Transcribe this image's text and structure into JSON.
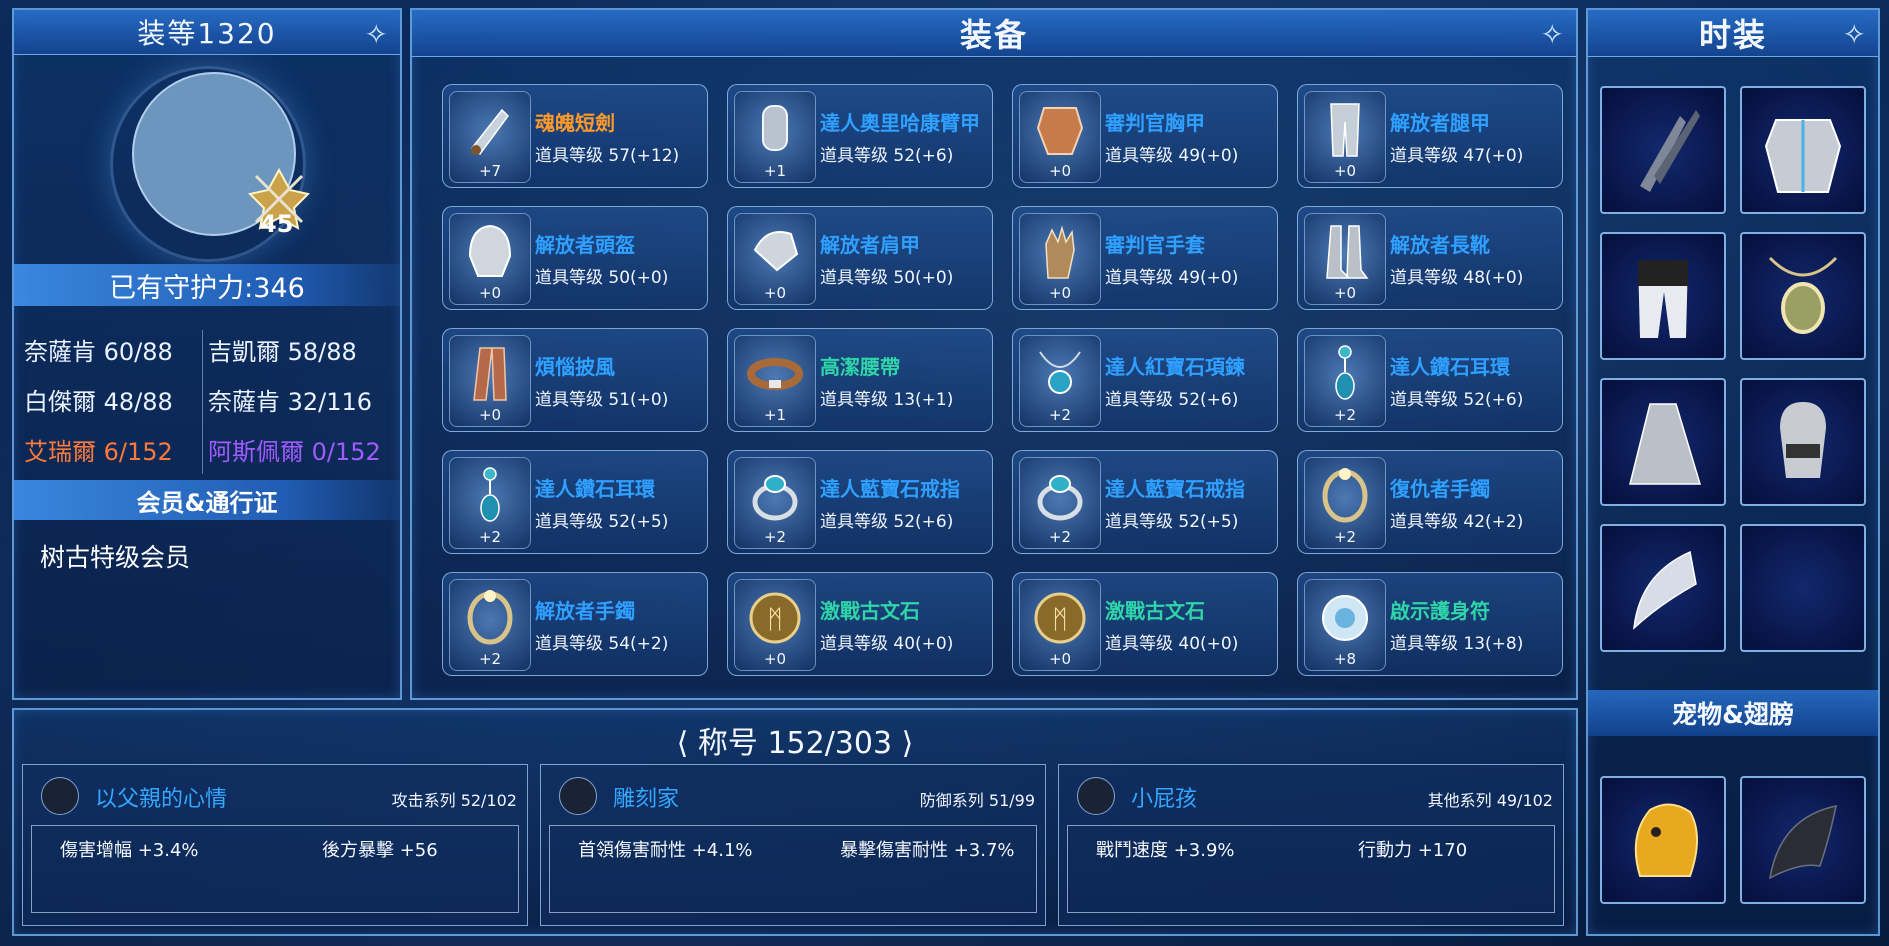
{
  "left_panel": {
    "gear_score": "装等1320",
    "level": "45",
    "guard_power": "已有守护力:346",
    "stats": [
      {
        "label": "奈薩肯 60/88",
        "color": "#eaf2ff"
      },
      {
        "label": "吉凱爾 58/88",
        "color": "#eaf2ff"
      },
      {
        "label": "白傑爾 48/88",
        "color": "#eaf2ff"
      },
      {
        "label": "奈薩肯 32/116",
        "color": "#eaf2ff"
      },
      {
        "label": "艾瑞爾 6/152",
        "color": "#ff7a3a"
      },
      {
        "label": "阿斯佩爾 0/152",
        "color": "#a05bff"
      }
    ],
    "membership_header": "会员&通行证",
    "membership": "树古特级会员"
  },
  "equipment": {
    "title": "装备",
    "items": [
      {
        "name": "魂魄短劍",
        "level": "道具等级 57(+12)",
        "plus": "+7",
        "name_color": "#ff9a2a",
        "icon": "dagger-icon"
      },
      {
        "name": "達人奧里哈康臂甲",
        "level": "道具等级 52(+6)",
        "plus": "+1",
        "name_color": "#2fa0ff",
        "icon": "bracer-icon"
      },
      {
        "name": "審判官胸甲",
        "level": "道具等级 49(+0)",
        "plus": "+0",
        "name_color": "#2fa0ff",
        "icon": "chest-armor-icon"
      },
      {
        "name": "解放者腿甲",
        "level": "道具等级 47(+0)",
        "plus": "+0",
        "name_color": "#2fa0ff",
        "icon": "leg-armor-icon"
      },
      {
        "name": "解放者頭盔",
        "level": "道具等级 50(+0)",
        "plus": "+0",
        "name_color": "#2fa0ff",
        "icon": "helmet-icon"
      },
      {
        "name": "解放者肩甲",
        "level": "道具等级 50(+0)",
        "plus": "+0",
        "name_color": "#2fa0ff",
        "icon": "shoulder-icon"
      },
      {
        "name": "審判官手套",
        "level": "道具等级 49(+0)",
        "plus": "+0",
        "name_color": "#2fa0ff",
        "icon": "glove-icon"
      },
      {
        "name": "解放者長靴",
        "level": "道具等级 48(+0)",
        "plus": "+0",
        "name_color": "#2fa0ff",
        "icon": "boots-icon"
      },
      {
        "name": "煩惱披風",
        "level": "道具等级 51(+0)",
        "plus": "+0",
        "name_color": "#2fa0ff",
        "icon": "cape-icon"
      },
      {
        "name": "高潔腰帶",
        "level": "道具等级 13(+1)",
        "plus": "+1",
        "name_color": "#2fd5a8",
        "icon": "belt-icon"
      },
      {
        "name": "達人紅寶石項鍊",
        "level": "道具等级 52(+6)",
        "plus": "+2",
        "name_color": "#2fa0ff",
        "icon": "necklace-icon"
      },
      {
        "name": "達人鑽石耳環",
        "level": "道具等级 52(+6)",
        "plus": "+2",
        "name_color": "#2fa0ff",
        "icon": "earring-icon"
      },
      {
        "name": "達人鑽石耳環",
        "level": "道具等级 52(+5)",
        "plus": "+2",
        "name_color": "#2fa0ff",
        "icon": "earring-icon"
      },
      {
        "name": "達人藍寶石戒指",
        "level": "道具等级 52(+6)",
        "plus": "+2",
        "name_color": "#2fa0ff",
        "icon": "ring-icon"
      },
      {
        "name": "達人藍寶石戒指",
        "level": "道具等级 52(+5)",
        "plus": "+2",
        "name_color": "#2fa0ff",
        "icon": "ring-icon"
      },
      {
        "name": "復仇者手鐲",
        "level": "道具等级 42(+2)",
        "plus": "+2",
        "name_color": "#2fa0ff",
        "icon": "bracelet-icon"
      },
      {
        "name": "解放者手鐲",
        "level": "道具等级 54(+2)",
        "plus": "+2",
        "name_color": "#2fa0ff",
        "icon": "bracelet-icon"
      },
      {
        "name": "激戰古文石",
        "level": "道具等级 40(+0)",
        "plus": "+0",
        "name_color": "#2fd5a8",
        "icon": "rune-stone-icon"
      },
      {
        "name": "激戰古文石",
        "level": "道具等级 40(+0)",
        "plus": "+0",
        "name_color": "#2fd5a8",
        "icon": "rune-stone-icon"
      },
      {
        "name": "啟示護身符",
        "level": "道具等级 13(+8)",
        "plus": "+8",
        "name_color": "#2fd5a8",
        "icon": "amulet-icon"
      }
    ]
  },
  "fashion": {
    "title": "时装",
    "slots": [
      "dagger-costume-icon",
      "armor-costume-icon",
      "pants-costume-icon",
      "necklace-costume-icon",
      "cape-costume-icon",
      "mask-costume-icon",
      "wing-costume-icon",
      "empty-slot"
    ],
    "pet_header": "宠物&翅膀",
    "pet_slots": [
      "pet-icon",
      "wings-icon"
    ]
  },
  "titles": {
    "header": "称号 152/303",
    "cards": [
      {
        "name": "以父親的心情",
        "category": "攻击系列 52/102",
        "stats": [
          "傷害增幅 +3.4%",
          "後方暴擊 +56"
        ]
      },
      {
        "name": "雕刻家",
        "category": "防御系列 51/99",
        "stats": [
          "首領傷害耐性 +4.1%",
          "暴擊傷害耐性 +3.7%"
        ]
      },
      {
        "name": "小屁孩",
        "category": "其他系列 49/102",
        "stats": [
          "戰鬥速度 +3.9%",
          "行動力 +170"
        ]
      }
    ]
  }
}
